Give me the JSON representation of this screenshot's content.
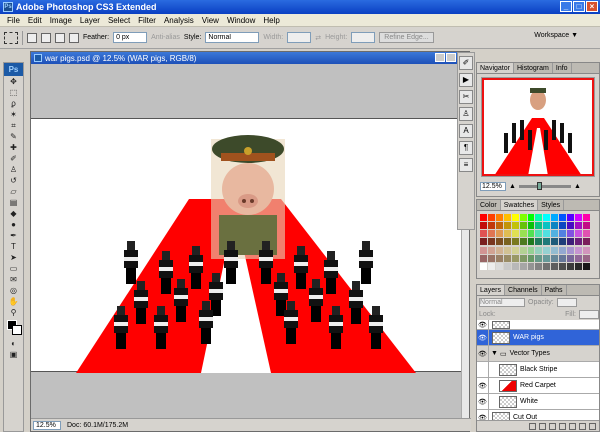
{
  "app": {
    "title": "Adobe Photoshop CS3 Extended"
  },
  "menu": [
    "File",
    "Edit",
    "Image",
    "Layer",
    "Select",
    "Filter",
    "Analysis",
    "View",
    "Window",
    "Help"
  ],
  "options": {
    "feather_label": "Feather:",
    "feather_value": "0 px",
    "antialias_label": "Anti-alias",
    "style_label": "Style:",
    "style_value": "Normal",
    "width_label": "Width:",
    "height_label": "Height:",
    "refine_label": "Refine Edge...",
    "workspace_label": "Workspace ▼"
  },
  "tools": {
    "logo": "Ps"
  },
  "document": {
    "title": "war pigs.psd @ 12.5% (WAR pigs, RGB/8)",
    "zoom": "12.5%",
    "doc_info": "Doc: 60.1M/175.2M"
  },
  "navigator": {
    "tabs": [
      "Navigator",
      "Histogram",
      "Info"
    ],
    "zoom": "12.5%"
  },
  "swatches": {
    "tabs": [
      "Color",
      "Swatches",
      "Styles"
    ]
  },
  "layers": {
    "tabs": [
      "Layers",
      "Channels",
      "Paths"
    ],
    "blend": "Normal",
    "opacity_label": "Opacity:",
    "lock_label": "Lock:",
    "fill_label": "Fill:",
    "rows": [
      {
        "name": "",
        "selected": false
      },
      {
        "name": "WAR pigs",
        "selected": true
      },
      {
        "name": "Vector Types",
        "selected": false
      },
      {
        "name": "Black Stripe",
        "selected": false
      },
      {
        "name": "Red Carpet",
        "selected": false
      },
      {
        "name": "White",
        "selected": false
      },
      {
        "name": "Cut Out",
        "selected": false
      }
    ]
  },
  "colors": {
    "carpet": "#ff0000",
    "selected_layer": "#3064d8",
    "titlebar": "#0a3fc2"
  }
}
